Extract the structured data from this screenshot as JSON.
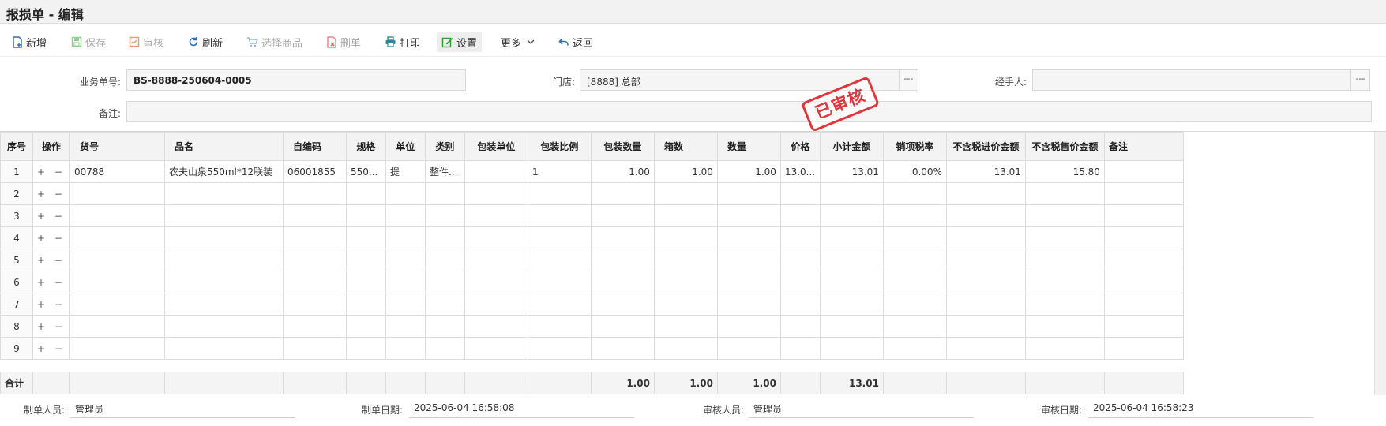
{
  "window": {
    "title": "报损单 - 编辑"
  },
  "toolbar": {
    "new_label": "新增",
    "save_label": "保存",
    "audit_label": "审核",
    "refresh_label": "刷新",
    "select_goods_label": "选择商品",
    "delete_label": "删单",
    "print_label": "打印",
    "settings_label": "设置",
    "more_label": "更多",
    "back_label": "返回"
  },
  "form": {
    "order_no_label": "业务单号:",
    "order_no_value": "BS-8888-250604-0005",
    "store_label": "门店:",
    "store_value": "[8888] 总部",
    "handler_label": "经手人:",
    "handler_value": "",
    "remark_label": "备注:",
    "remark_value": "",
    "picker_label": "---",
    "stamp_text": "已审核"
  },
  "grid": {
    "columns": [
      "序号",
      "操作",
      "货号",
      "品名",
      "自编码",
      "规格",
      "单位",
      "类别",
      "包装单位",
      "包装比例",
      "包装数量",
      "箱数",
      "数量",
      "价格",
      "小计金额",
      "销项税率",
      "不含税进价金额",
      "不含税售价金额",
      "备注"
    ],
    "op_symbols": "+ −",
    "rows": [
      [
        "1",
        "00788",
        "农夫山泉550ml*12联装",
        "06001855",
        "550...",
        "提",
        "整件...",
        "",
        "1",
        "1.00",
        "1.00",
        "1.00",
        "13.0...",
        "13.01",
        "0.00%",
        "13.01",
        "15.80",
        ""
      ],
      [
        "2",
        "",
        "",
        "",
        "",
        "",
        "",
        "",
        "",
        "",
        "",
        "",
        "",
        "",
        "",
        "",
        "",
        ""
      ],
      [
        "3",
        "",
        "",
        "",
        "",
        "",
        "",
        "",
        "",
        "",
        "",
        "",
        "",
        "",
        "",
        "",
        "",
        ""
      ],
      [
        "4",
        "",
        "",
        "",
        "",
        "",
        "",
        "",
        "",
        "",
        "",
        "",
        "",
        "",
        "",
        "",
        "",
        ""
      ],
      [
        "5",
        "",
        "",
        "",
        "",
        "",
        "",
        "",
        "",
        "",
        "",
        "",
        "",
        "",
        "",
        "",
        "",
        ""
      ],
      [
        "6",
        "",
        "",
        "",
        "",
        "",
        "",
        "",
        "",
        "",
        "",
        "",
        "",
        "",
        "",
        "",
        "",
        ""
      ],
      [
        "7",
        "",
        "",
        "",
        "",
        "",
        "",
        "",
        "",
        "",
        "",
        "",
        "",
        "",
        "",
        "",
        "",
        ""
      ],
      [
        "8",
        "",
        "",
        "",
        "",
        "",
        "",
        "",
        "",
        "",
        "",
        "",
        "",
        "",
        "",
        "",
        "",
        ""
      ],
      [
        "9",
        "",
        "",
        "",
        "",
        "",
        "",
        "",
        "",
        "",
        "",
        "",
        "",
        "",
        "",
        "",
        "",
        ""
      ]
    ],
    "totals": {
      "label": "合计",
      "pack_qty": "1.00",
      "boxes": "1.00",
      "qty": "1.00",
      "subtotal": "13.01"
    }
  },
  "footer": {
    "creator_label": "制单人员:",
    "creator_value": "管理员",
    "create_date_label": "制单日期:",
    "create_date_value": "2025-06-04 16:58:08",
    "auditor_label": "审核人员:",
    "auditor_value": "管理员",
    "audit_date_label": "审核日期:",
    "audit_date_value": "2025-06-04 16:58:23"
  },
  "colors": {
    "stamp": "#e2242b",
    "accent_blue": "#2f6fb8",
    "accent_green": "#3a9a3a"
  },
  "icons": [
    "new-doc-icon",
    "save-icon",
    "audit-check-icon",
    "refresh-icon",
    "cart-icon",
    "delete-doc-icon",
    "printer-icon",
    "settings-edit-icon",
    "chevron-down-icon",
    "back-arrow-icon"
  ]
}
